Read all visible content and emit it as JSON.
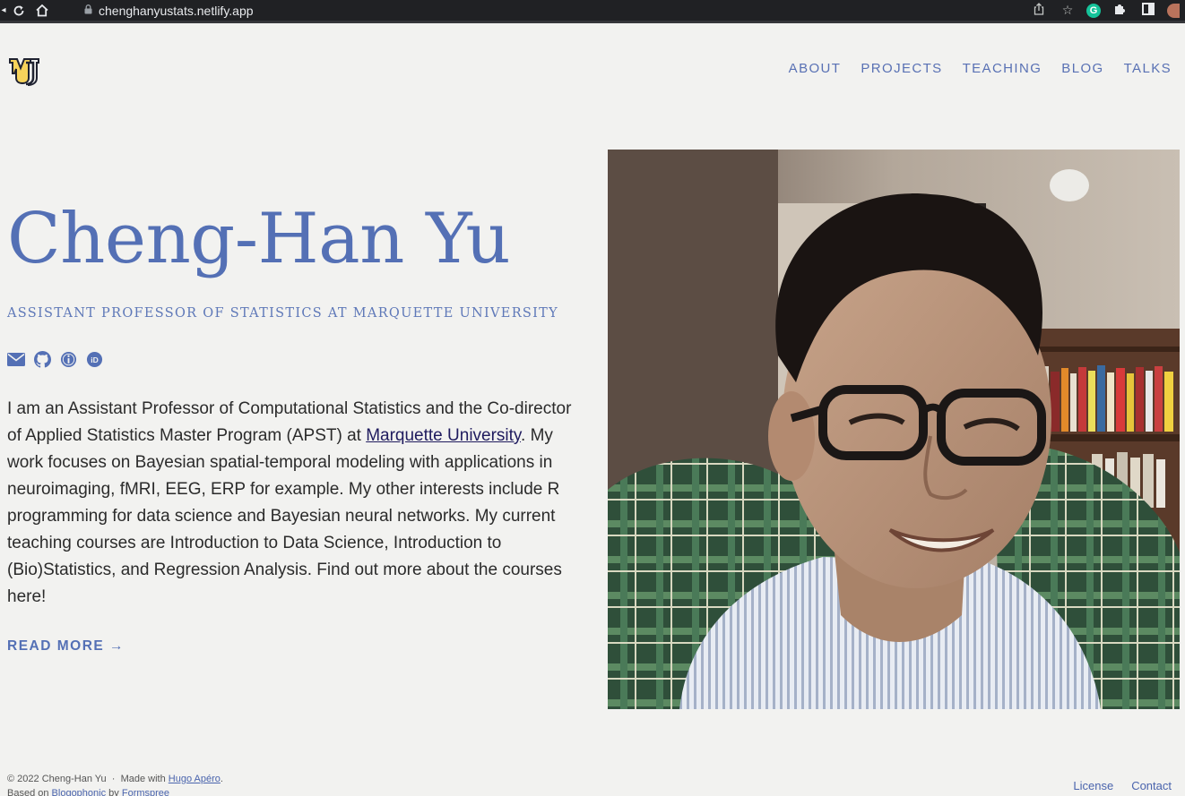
{
  "browser": {
    "url": "chenghanyustats.netlify.app",
    "back_icon": "back-icon",
    "reload_icon": "reload-icon",
    "home_icon": "home-icon",
    "lock_icon": "lock-icon",
    "share_icon": "share-icon",
    "bookmark_icon": "star-icon",
    "grammarly_label": "G",
    "extensions_icon": "puzzle-icon",
    "sidepanel_icon": "sidebar-icon"
  },
  "header": {
    "logo_icon": "marquette-mu-logo",
    "nav": [
      {
        "label": "ABOUT"
      },
      {
        "label": "PROJECTS"
      },
      {
        "label": "TEACHING"
      },
      {
        "label": "BLOG"
      },
      {
        "label": "TALKS"
      }
    ]
  },
  "hero": {
    "name": "Cheng-Han Yu",
    "subtitle": "ASSISTANT PROFESSOR OF STATISTICS AT MARQUETTE UNIVERSITY",
    "socials": [
      "email-icon",
      "github-icon",
      "info-icon",
      "orcid-icon"
    ],
    "bio": {
      "before_link": "I am an Assistant Professor of Computational Statistics and the Co-director of Applied Statistics Master Program (APST) at ",
      "link_text": "Marquette University",
      "after_link": ". My work focuses on Bayesian spatial-temporal modeling with applications in neuroimaging, fMRI, EEG, ERP for example. My other interests include R programming for data science and Bayesian neural networks. My current teaching courses are Introduction to Data Science, Introduction to (Bio)Statistics, and Regression Analysis. Find out more about the courses here!"
    },
    "read_more": "READ MORE →"
  },
  "photo": {
    "subject": "portrait photo"
  },
  "footer": {
    "copyright": "© 2022 Cheng-Han Yu",
    "separator": "·",
    "made_with": "Made with",
    "made_with_link": "Hugo Apéro",
    "made_with_end": ".",
    "based_on": "Based on",
    "based_on_link": "Blogophonic",
    "by": "by",
    "by_link": "Formspree",
    "license": "License",
    "contact": "Contact"
  },
  "colors": {
    "accent": "#5470b5",
    "background": "#f2f2f0",
    "text": "#2b2b2b",
    "link_dark": "#1f1b5e"
  }
}
